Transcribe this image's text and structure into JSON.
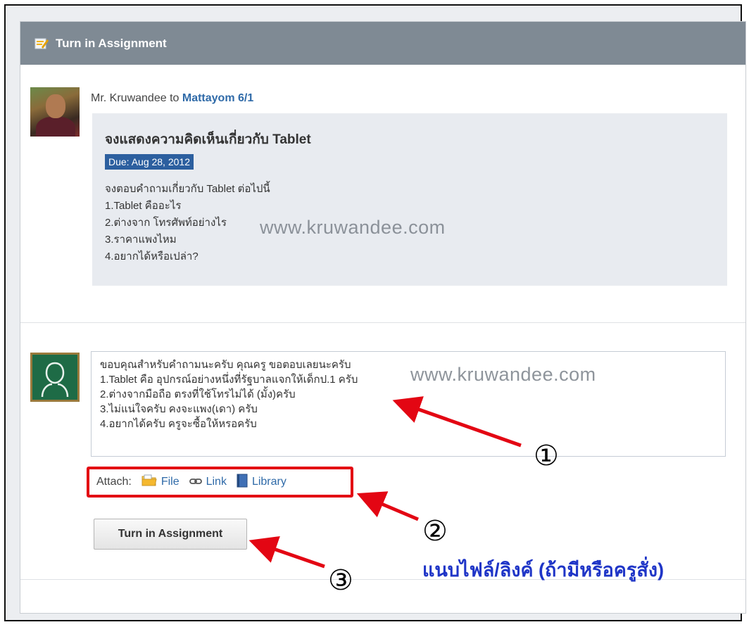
{
  "panel": {
    "title": "Turn in Assignment"
  },
  "post": {
    "author": "Mr. Kruwandee",
    "connector": "to",
    "group": "Mattayom 6/1"
  },
  "assignment": {
    "title": "จงแสดงความคิดเห็นเกี่ยวกับ Tablet",
    "due": "Due: Aug 28, 2012",
    "lines": [
      "จงตอบคำถามเกี่ยวกับ Tablet ต่อไปนี้",
      "1.Tablet คืออะไร",
      "2.ต่างจาก โทรศัพท์อย่างไร",
      "3.ราคาแพงไหม",
      "4.อยากได้หรือเปล่า?"
    ]
  },
  "watermark": "www.kruwandee.com",
  "answer": {
    "lines": [
      "ขอบคุณสำหรับคำถามนะครับ คุณครู ขอตอบเลยนะครับ",
      "1.Tablet คือ อุปกรณ์อย่างหนึ่งที่รัฐบาลแจกให้เด็กป.1 ครับ",
      "2.ต่างจากมือถือ ตรงที่ใช้โทรไม่ได้ (มั้ง)ครับ",
      "3.ไม่แน่ใจครับ คงจะแพง(เดา) ครับ",
      "4.อยากได้ครับ ครูจะซื้อให้หรอครับ"
    ]
  },
  "attach": {
    "label": "Attach:",
    "file": "File",
    "link": "Link",
    "library": "Library"
  },
  "submit_label": "Turn in Assignment",
  "annotations": {
    "one": "①",
    "two": "②",
    "three": "③",
    "caption": "แนบไฟล์/ลิงค์ (ถ้ามีหรือครูสั่ง)",
    "arrow_color": "#e30613"
  }
}
